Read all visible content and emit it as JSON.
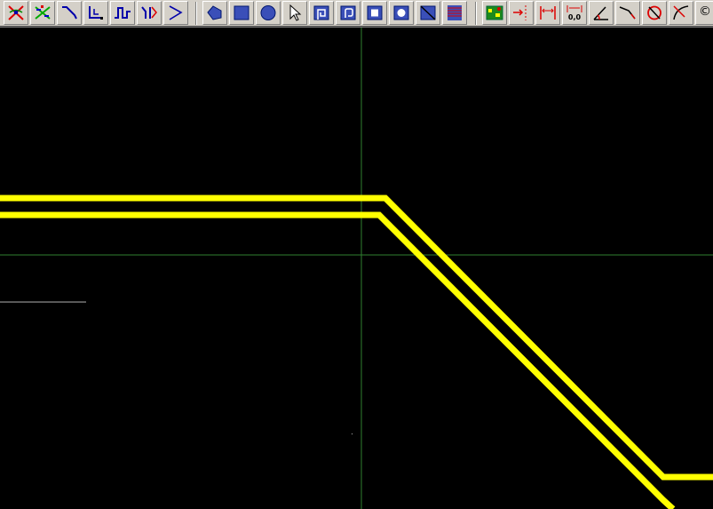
{
  "toolbar": {
    "groups": [
      {
        "name": "routing",
        "buttons": [
          "route-x-icon",
          "route-multi-icon",
          "trace-icon",
          "right-angle-trace-icon",
          "meander-icon",
          "fanout-icon",
          "chevron-icon"
        ]
      },
      {
        "name": "shapes",
        "buttons": [
          "polygon-icon",
          "rectangle-icon",
          "circle-icon",
          "pointer-icon",
          "square-spiral-icon",
          "round-spiral-icon",
          "square-pad-icon",
          "round-pad-icon",
          "hatch-icon",
          "text-block-icon"
        ]
      },
      {
        "name": "measure",
        "buttons": [
          "drc-board-icon",
          "align-marker-icon",
          "dimension-icon",
          "dimension-h-icon",
          "coordinate-icon",
          "angle-icon",
          "arc-line-icon",
          "circle-cross-icon",
          "arc-icon",
          "copyright-icon"
        ]
      }
    ],
    "copyright_glyph": "©"
  },
  "canvas": {
    "background_color": "#000000",
    "trace_color": "#ffff00",
    "crosshair_color": "#2f7f2f",
    "guide_color": "#b0b0b0"
  }
}
